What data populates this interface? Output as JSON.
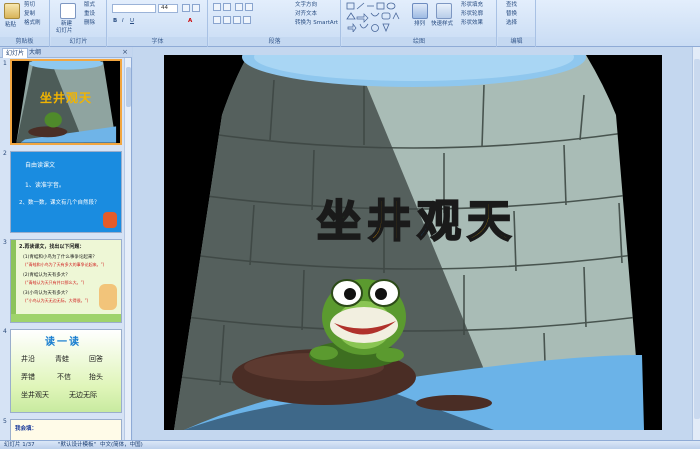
{
  "ribbon": {
    "clipboard": {
      "paste": "粘贴",
      "cut": "剪切",
      "copy": "复制",
      "format_painter": "格式刷",
      "group": "剪贴板"
    },
    "slides": {
      "new_slide": "新建",
      "new_slide2": "幻灯片",
      "layout": "版式",
      "reset": "重设",
      "delete": "删除",
      "group": "幻灯片"
    },
    "font": {
      "font_size": "44",
      "group": "字体"
    },
    "paragraph": {
      "text_direction": "文字方向",
      "align_text": "对齐文本",
      "smartart": "转换为 SmartArt",
      "group": "段落"
    },
    "drawing": {
      "arrange": "排列",
      "quick_styles": "快速样式",
      "shape_fill": "形状填充",
      "shape_outline": "形状轮廓",
      "shape_effects": "形状效果",
      "group": "绘图"
    },
    "editing": {
      "find": "查找",
      "replace": "替换",
      "select": "选择",
      "group": "编辑"
    }
  },
  "panel": {
    "tab_slides": "幻灯片",
    "tab_outline": "大纲",
    "close": "×"
  },
  "thumbs": {
    "s1": {
      "num": "1",
      "title": "坐井观天"
    },
    "s2": {
      "num": "2",
      "heading": "自由读课文",
      "line1": "1、读准字音。",
      "line2": "2、数一数，课文有几个自然段？"
    },
    "s3": {
      "num": "3",
      "heading": "2.再读课文，找出以下问题：",
      "q1": "(1)青蛙和小鸟为了什么事争论起来？",
      "a1": "(“青蛙和小鸟为了天有多大的事争论起来。”)",
      "q2": "(2)青蛙认为天有多大？",
      "a2": "(“青蛙认为天只有井口那么大。”)",
      "q3": "(3)小鸟认为天有多大？",
      "a3": "(“小鸟认为天无边无际，大得很。”)"
    },
    "s4": {
      "num": "4",
      "heading": "读一读",
      "w1": "井沿",
      "w2": "青蛙",
      "w3": "回答",
      "w4": "弄错",
      "w5": "不信",
      "w6": "抬头",
      "w7": "坐井观天",
      "w8": "无边无际"
    },
    "s5": {
      "num": "5",
      "heading": "我会填："
    }
  },
  "slide": {
    "title_chars": [
      "坐",
      "井",
      "观",
      "天"
    ],
    "title_colors": [
      "#35b61f",
      "#f5a400",
      "#1f8ee8",
      "#f2b400"
    ]
  },
  "status": {
    "slide_info": "幻灯片 1/37",
    "theme": "\"默认设计模板\"",
    "language": "中文(简体，中国)"
  }
}
